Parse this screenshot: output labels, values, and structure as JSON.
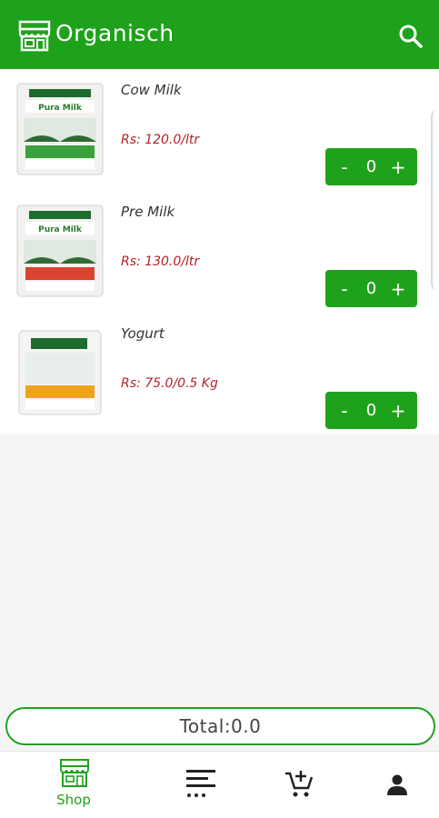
{
  "app": {
    "title": "Organisch"
  },
  "products": [
    {
      "name": "Cow Milk",
      "price": "Rs: 120.0/ltr",
      "quantity": "0",
      "decrement": "-",
      "increment": "+",
      "pack_label": "Pura Milk",
      "pack_band": "green"
    },
    {
      "name": "Pre Milk",
      "price": "Rs: 130.0/ltr",
      "quantity": "0",
      "decrement": "-",
      "increment": "+",
      "pack_label": "Pura Milk",
      "pack_band": "red"
    },
    {
      "name": "Yogurt",
      "price": "Rs: 75.0/0.5 Kg",
      "quantity": "0",
      "decrement": "-",
      "increment": "+",
      "pack_label": "",
      "pack_band": "orange"
    }
  ],
  "total": {
    "text": "Total:0.0"
  },
  "nav": {
    "items": [
      {
        "label": "Shop",
        "icon": "shop-icon",
        "active": true
      },
      {
        "label": "",
        "icon": "list-icon",
        "active": false
      },
      {
        "label": "",
        "icon": "cart-add-icon",
        "active": false
      },
      {
        "label": "",
        "icon": "profile-icon",
        "active": false
      }
    ]
  },
  "colors": {
    "primary": "#1fa21b",
    "price": "#b4232a",
    "background": "#f5f5f5"
  }
}
